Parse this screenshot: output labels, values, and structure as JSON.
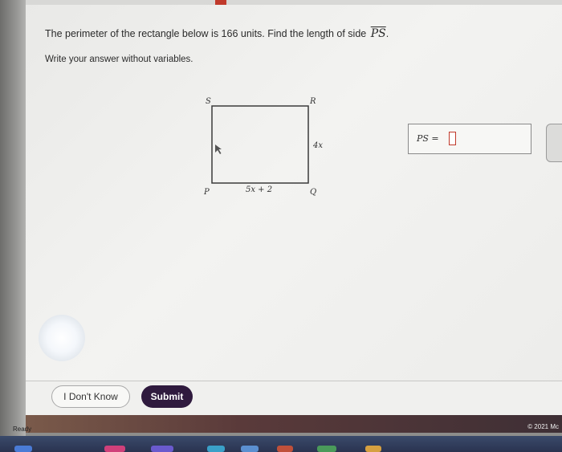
{
  "question": {
    "text": "The perimeter of the rectangle below is 166 units. Find the length of side",
    "segment": "PS",
    "end": "."
  },
  "instruction": "Write your answer without variables.",
  "figure": {
    "vertices": {
      "top_left": "S",
      "top_right": "R",
      "bottom_left": "P",
      "bottom_right": "Q"
    },
    "right_side_label": "4x",
    "bottom_side_label": "5x + 2"
  },
  "answer": {
    "label": "PS =",
    "value": ""
  },
  "buttons": {
    "dont_know": "I Don't Know",
    "submit": "Submit"
  },
  "footer": {
    "copyright": "© 2021 Mc",
    "status": "Ready"
  },
  "colors": {
    "submit_bg": "#2f1a3e",
    "input_border": "#c0392b"
  }
}
